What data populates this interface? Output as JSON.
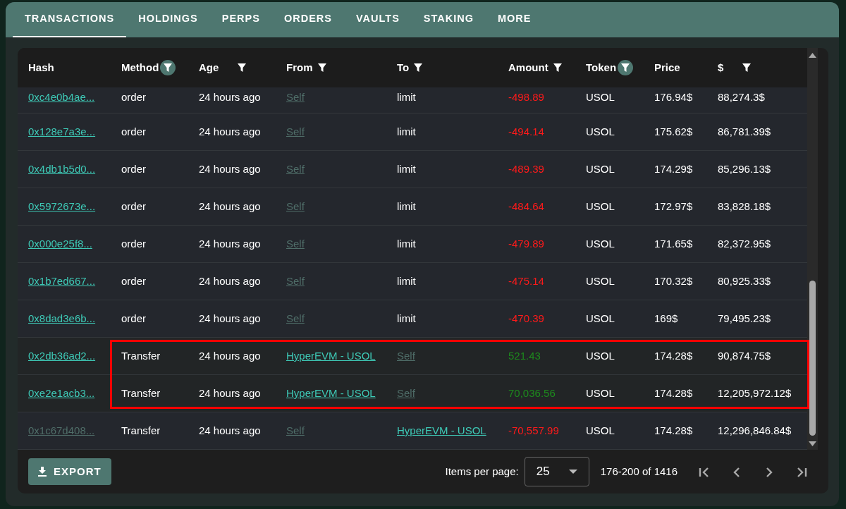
{
  "tabs": [
    {
      "label": "TRANSACTIONS",
      "selected": true
    },
    {
      "label": "HOLDINGS",
      "selected": false
    },
    {
      "label": "PERPS",
      "selected": false
    },
    {
      "label": "ORDERS",
      "selected": false
    },
    {
      "label": "VAULTS",
      "selected": false
    },
    {
      "label": "STAKING",
      "selected": false
    },
    {
      "label": "MORE",
      "selected": false
    }
  ],
  "table": {
    "columns": [
      {
        "label": "Hash",
        "filterable": false
      },
      {
        "label": "Method",
        "filterable": true,
        "filter_active": true
      },
      {
        "label": "Age",
        "filterable": true,
        "filter_active": false
      },
      {
        "label": "From",
        "filterable": true,
        "filter_active": false
      },
      {
        "label": "To",
        "filterable": true,
        "filter_active": false
      },
      {
        "label": "Amount",
        "filterable": true,
        "filter_active": false
      },
      {
        "label": "Token",
        "filterable": true,
        "filter_active": true
      },
      {
        "label": "Price",
        "filterable": false
      },
      {
        "label": "$",
        "filterable": true,
        "filter_active": false
      }
    ],
    "rows": [
      {
        "hash": "0xc4e0b4ae...",
        "hash_dimmed": false,
        "method": "order",
        "age": "24 hours ago",
        "from": {
          "text": "Self",
          "kind": "self"
        },
        "to": {
          "text": "limit",
          "kind": "text"
        },
        "amount": "-498.89",
        "negative": true,
        "token": "USOL",
        "price": "176.94$",
        "usd": "88,274.3$",
        "highlighted": false
      },
      {
        "hash": "0x128e7a3e...",
        "hash_dimmed": false,
        "method": "order",
        "age": "24 hours ago",
        "from": {
          "text": "Self",
          "kind": "self"
        },
        "to": {
          "text": "limit",
          "kind": "text"
        },
        "amount": "-494.14",
        "negative": true,
        "token": "USOL",
        "price": "175.62$",
        "usd": "86,781.39$",
        "highlighted": false
      },
      {
        "hash": "0x4db1b5d0...",
        "hash_dimmed": false,
        "method": "order",
        "age": "24 hours ago",
        "from": {
          "text": "Self",
          "kind": "self"
        },
        "to": {
          "text": "limit",
          "kind": "text"
        },
        "amount": "-489.39",
        "negative": true,
        "token": "USOL",
        "price": "174.29$",
        "usd": "85,296.13$",
        "highlighted": false
      },
      {
        "hash": "0x5972673e...",
        "hash_dimmed": false,
        "method": "order",
        "age": "24 hours ago",
        "from": {
          "text": "Self",
          "kind": "self"
        },
        "to": {
          "text": "limit",
          "kind": "text"
        },
        "amount": "-484.64",
        "negative": true,
        "token": "USOL",
        "price": "172.97$",
        "usd": "83,828.18$",
        "highlighted": false
      },
      {
        "hash": "0x000e25f8...",
        "hash_dimmed": false,
        "method": "order",
        "age": "24 hours ago",
        "from": {
          "text": "Self",
          "kind": "self"
        },
        "to": {
          "text": "limit",
          "kind": "text"
        },
        "amount": "-479.89",
        "negative": true,
        "token": "USOL",
        "price": "171.65$",
        "usd": "82,372.95$",
        "highlighted": false
      },
      {
        "hash": "0x1b7ed667...",
        "hash_dimmed": false,
        "method": "order",
        "age": "24 hours ago",
        "from": {
          "text": "Self",
          "kind": "self"
        },
        "to": {
          "text": "limit",
          "kind": "text"
        },
        "amount": "-475.14",
        "negative": true,
        "token": "USOL",
        "price": "170.32$",
        "usd": "80,925.33$",
        "highlighted": false
      },
      {
        "hash": "0x8dad3e6b...",
        "hash_dimmed": false,
        "method": "order",
        "age": "24 hours ago",
        "from": {
          "text": "Self",
          "kind": "self"
        },
        "to": {
          "text": "limit",
          "kind": "text"
        },
        "amount": "-470.39",
        "negative": true,
        "token": "USOL",
        "price": "169$",
        "usd": "79,495.23$",
        "highlighted": false
      },
      {
        "hash": "0x2db36ad2...",
        "hash_dimmed": false,
        "method": "Transfer",
        "age": "24 hours ago",
        "from": {
          "text": "HyperEVM - USOL",
          "kind": "link"
        },
        "to": {
          "text": "Self",
          "kind": "self"
        },
        "amount": "521.43",
        "negative": false,
        "token": "USOL",
        "price": "174.28$",
        "usd": "90,874.75$",
        "highlighted": true
      },
      {
        "hash": "0xe2e1acb3...",
        "hash_dimmed": false,
        "method": "Transfer",
        "age": "24 hours ago",
        "from": {
          "text": "HyperEVM - USOL",
          "kind": "link"
        },
        "to": {
          "text": "Self",
          "kind": "self"
        },
        "amount": "70,036.56",
        "negative": false,
        "token": "USOL",
        "price": "174.28$",
        "usd": "12,205,972.12$",
        "highlighted": true
      },
      {
        "hash": "0x1c67d408...",
        "hash_dimmed": true,
        "method": "Transfer",
        "age": "24 hours ago",
        "from": {
          "text": "Self",
          "kind": "self"
        },
        "to": {
          "text": "HyperEVM - USOL",
          "kind": "link"
        },
        "amount": "-70,557.99",
        "negative": true,
        "token": "USOL",
        "price": "174.28$",
        "usd": "12,296,846.84$",
        "highlighted": false
      }
    ]
  },
  "footer": {
    "export_label": "EXPORT",
    "items_per_page_label": "Items per page:",
    "items_per_page": "25",
    "range": "176-200 of 1416"
  }
}
